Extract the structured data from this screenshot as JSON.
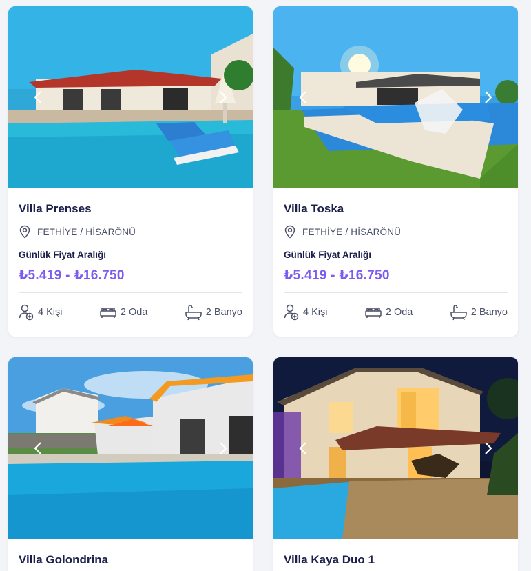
{
  "cards": [
    {
      "title": "Villa Prenses",
      "location": "FETHİYE / HİSARÖNÜ",
      "price_label": "Günlük Fiyat Aralığı",
      "price": "₺5.419 - ₺16.750",
      "guests": "4 Kişi",
      "rooms": "2 Oda",
      "baths": "2 Banyo"
    },
    {
      "title": "Villa Toska",
      "location": "FETHİYE / HİSARÖNÜ",
      "price_label": "Günlük Fiyat Aralığı",
      "price": "₺5.419 - ₺16.750",
      "guests": "4 Kişi",
      "rooms": "2 Oda",
      "baths": "2 Banyo"
    },
    {
      "title": "Villa Golondrina"
    },
    {
      "title": "Villa Kaya Duo 1"
    }
  ],
  "colors": {
    "accent_price": "#7b5cf0",
    "title_text": "#1b1f4a",
    "background": "#f3f4f8"
  },
  "icons": [
    "chevron-left-icon",
    "chevron-right-icon",
    "location-pin-icon",
    "person-add-icon",
    "bed-icon",
    "bathtub-icon"
  ]
}
